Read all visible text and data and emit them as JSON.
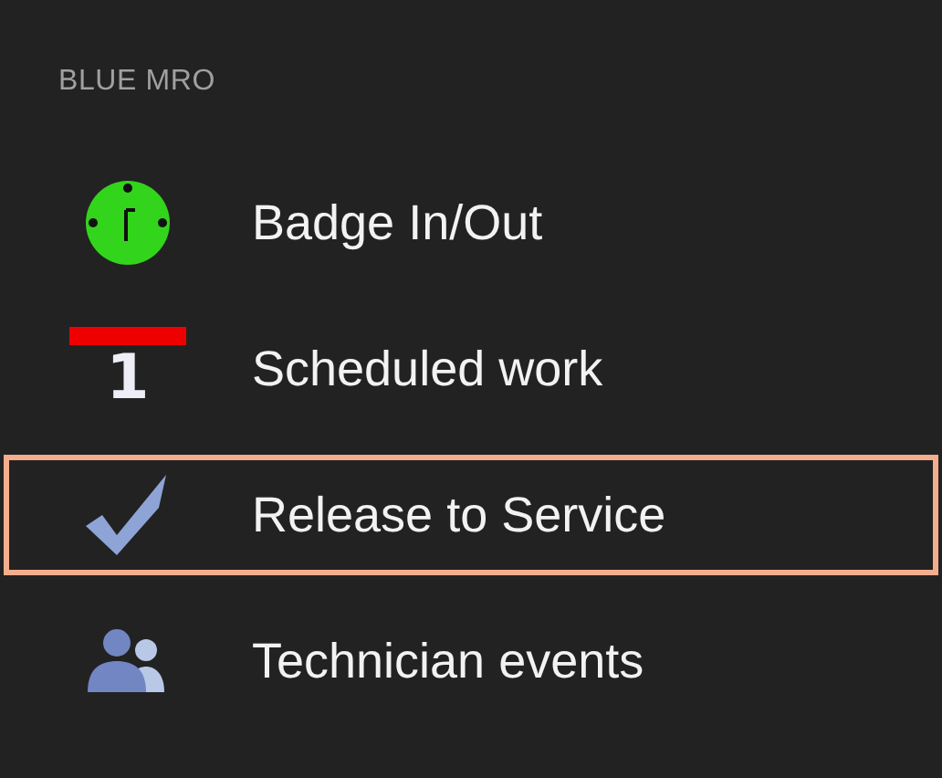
{
  "section_title": "BLUE MRO",
  "items": [
    {
      "kind": "clock",
      "label": "Badge In/Out",
      "selected": false
    },
    {
      "kind": "calendar",
      "icon_text": "1",
      "label": "Scheduled work",
      "selected": false
    },
    {
      "kind": "check",
      "label": "Release to Service",
      "selected": true
    },
    {
      "kind": "people",
      "label": "Technician events",
      "selected": false
    }
  ]
}
